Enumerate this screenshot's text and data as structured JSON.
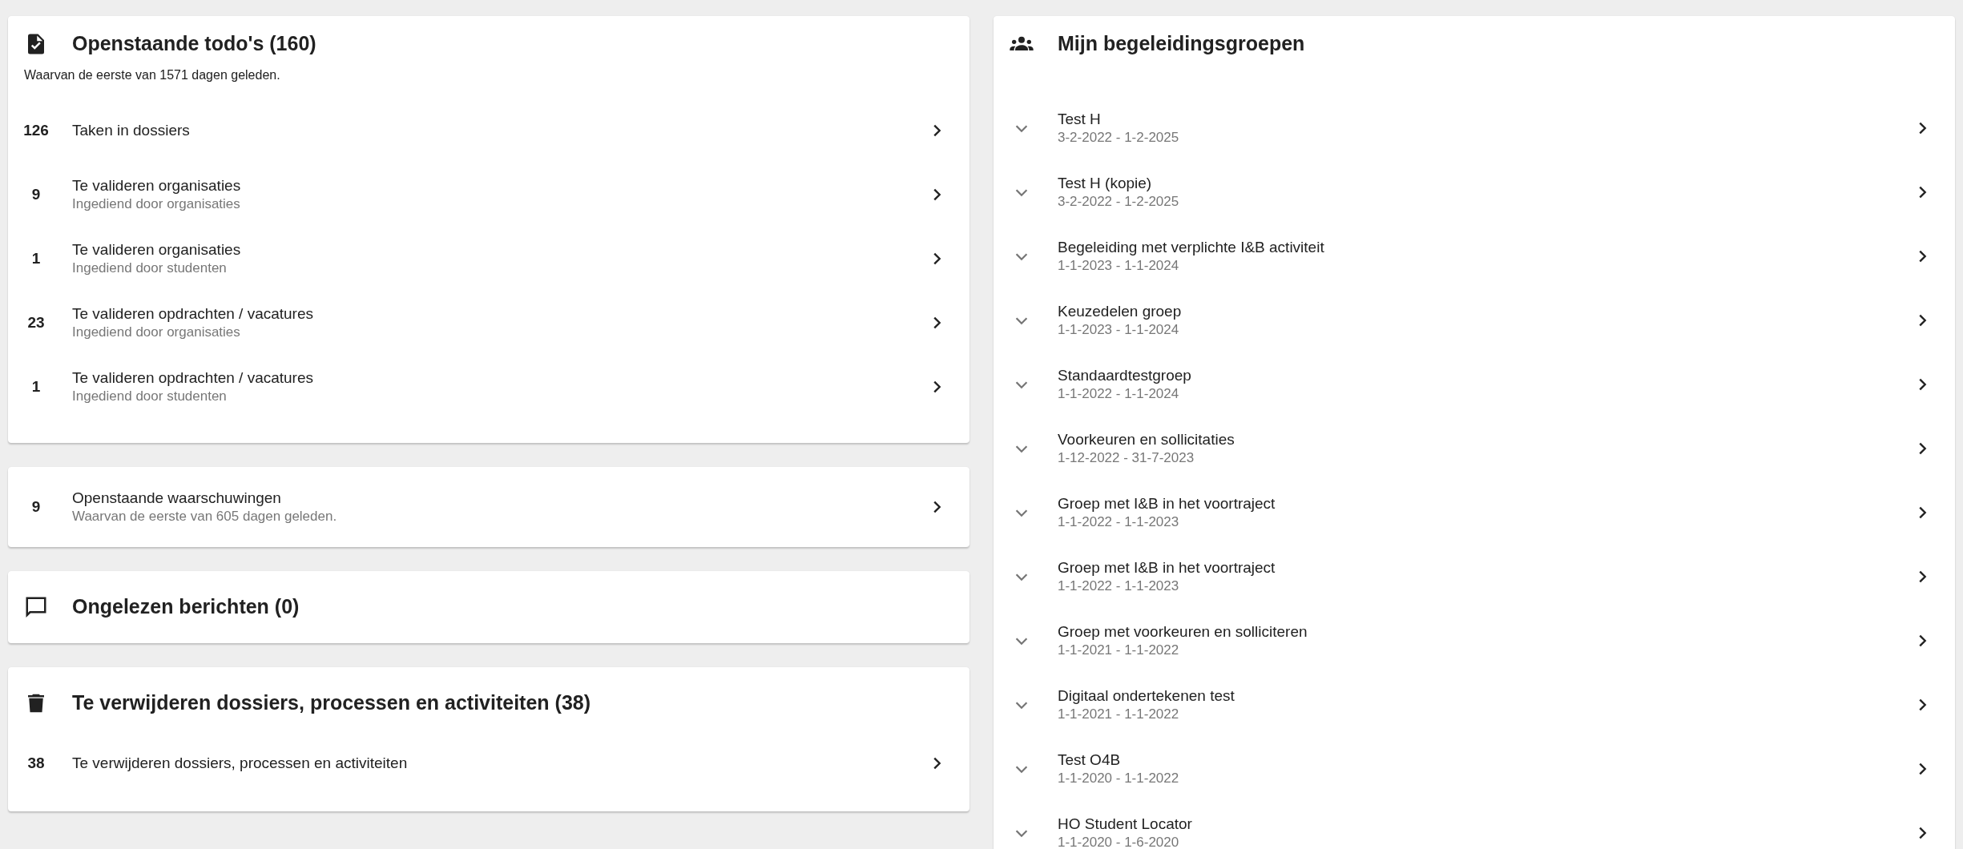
{
  "todos": {
    "title": "Openstaande todo's (160)",
    "subtitle": "Waarvan de eerste van 1571 dagen geleden.",
    "items": [
      {
        "count": "126",
        "title": "Taken in dossiers"
      },
      {
        "count": "9",
        "title": "Te valideren organisaties",
        "subtitle": "Ingediend door organisaties"
      },
      {
        "count": "1",
        "title": "Te valideren organisaties",
        "subtitle": "Ingediend door studenten"
      },
      {
        "count": "23",
        "title": "Te valideren opdrachten / vacatures",
        "subtitle": "Ingediend door organisaties"
      },
      {
        "count": "1",
        "title": "Te valideren opdrachten / vacatures",
        "subtitle": "Ingediend door studenten"
      }
    ]
  },
  "warnings": {
    "items": [
      {
        "count": "9",
        "title": "Openstaande waarschuwingen",
        "subtitle": "Waarvan de eerste van 605 dagen geleden."
      }
    ]
  },
  "messages": {
    "title": "Ongelezen berichten (0)"
  },
  "deletions": {
    "title": "Te verwijderen dossiers, processen en activiteiten (38)",
    "items": [
      {
        "count": "38",
        "title": "Te verwijderen dossiers, processen en activiteiten"
      }
    ]
  },
  "groups": {
    "title": "Mijn begeleidingsgroepen",
    "items": [
      {
        "name": "Test H",
        "period": "3-2-2022 - 1-2-2025",
        "expanded": false
      },
      {
        "name": "Test H (kopie)",
        "period": "3-2-2022 - 1-2-2025",
        "expanded": false
      },
      {
        "name": "Begeleiding met verplichte I&B activiteit",
        "period": "1-1-2023 - 1-1-2024",
        "expanded": false
      },
      {
        "name": "Keuzedelen groep",
        "period": "1-1-2023 - 1-1-2024",
        "expanded": false
      },
      {
        "name": "Standaardtestgroep",
        "period": "1-1-2022 - 1-1-2024",
        "expanded": false
      },
      {
        "name": "Voorkeuren en sollicitaties",
        "period": "1-12-2022 - 31-7-2023",
        "expanded": false
      },
      {
        "name": "Groep met I&B in het voortraject",
        "period": "1-1-2022 - 1-1-2023",
        "expanded": false
      },
      {
        "name": "Groep met I&B in het voortraject",
        "period": "1-1-2022 - 1-1-2023",
        "expanded": false
      },
      {
        "name": "Groep met voorkeuren en solliciteren",
        "period": "1-1-2021 - 1-1-2022",
        "expanded": false
      },
      {
        "name": "Digitaal ondertekenen test",
        "period": "1-1-2021 - 1-1-2022",
        "expanded": false
      },
      {
        "name": "Test O4B",
        "period": "1-1-2020 - 1-1-2022",
        "expanded": false
      },
      {
        "name": "HO Student Locator",
        "period": "1-1-2020 - 1-6-2020",
        "expanded": false
      }
    ]
  }
}
